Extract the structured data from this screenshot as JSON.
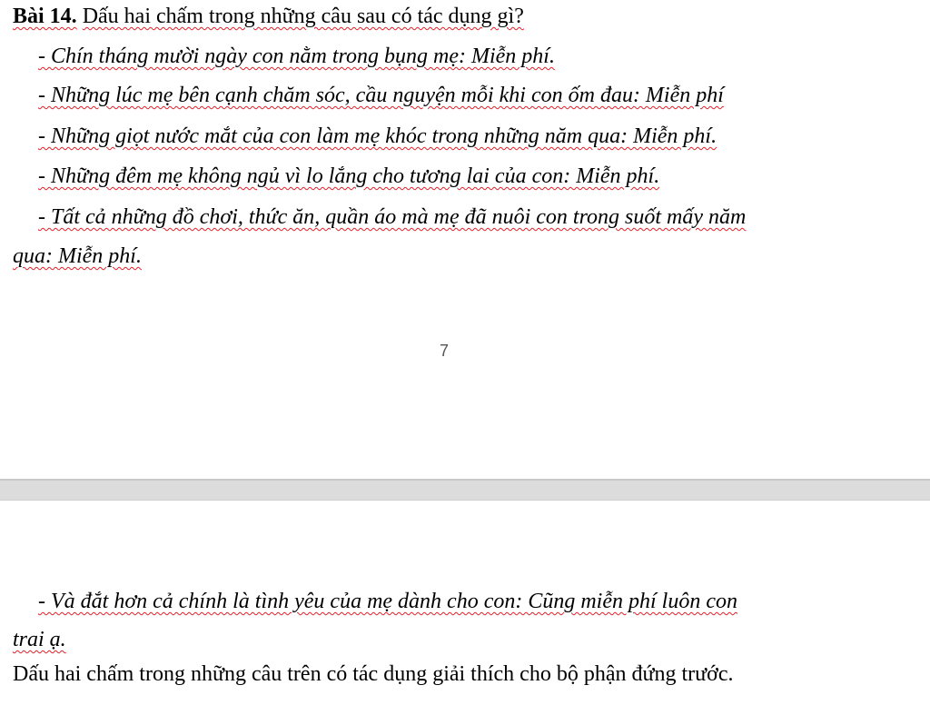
{
  "document": {
    "page_top": {
      "title": {
        "number": "Bài 14.",
        "question": "Dấu hai chấm trong những câu sau có tác dụng gì?"
      },
      "lines": [
        "- Chín tháng mười ngày con nằm trong bụng mẹ: Miễn phí.",
        "- Những lúc mẹ bên cạnh chăm sóc, cầu nguyện mỗi khi con ốm đau: Miễn phí",
        "- Những giọt nước mắt của con làm mẹ khóc trong những năm qua: Miễn phí.",
        "- Những đêm mẹ không ngủ vì lo lắng cho tương lai của con: Miễn phí.",
        "- Tất cả những đồ chơi, thức ăn, quần áo mà mẹ đã nuôi con trong suốt mấy năm",
        "qua: Miễn phí."
      ],
      "page_number": "7"
    },
    "page_bottom": {
      "lines": [
        "- Và đắt hơn cả chính là tình yêu của mẹ dành cho con: Cũng miễn phí luôn con",
        "trai ạ."
      ],
      "answer": "Dấu hai chấm trong những câu trên có tác dụng giải thích cho bộ phận đứng trước."
    }
  }
}
